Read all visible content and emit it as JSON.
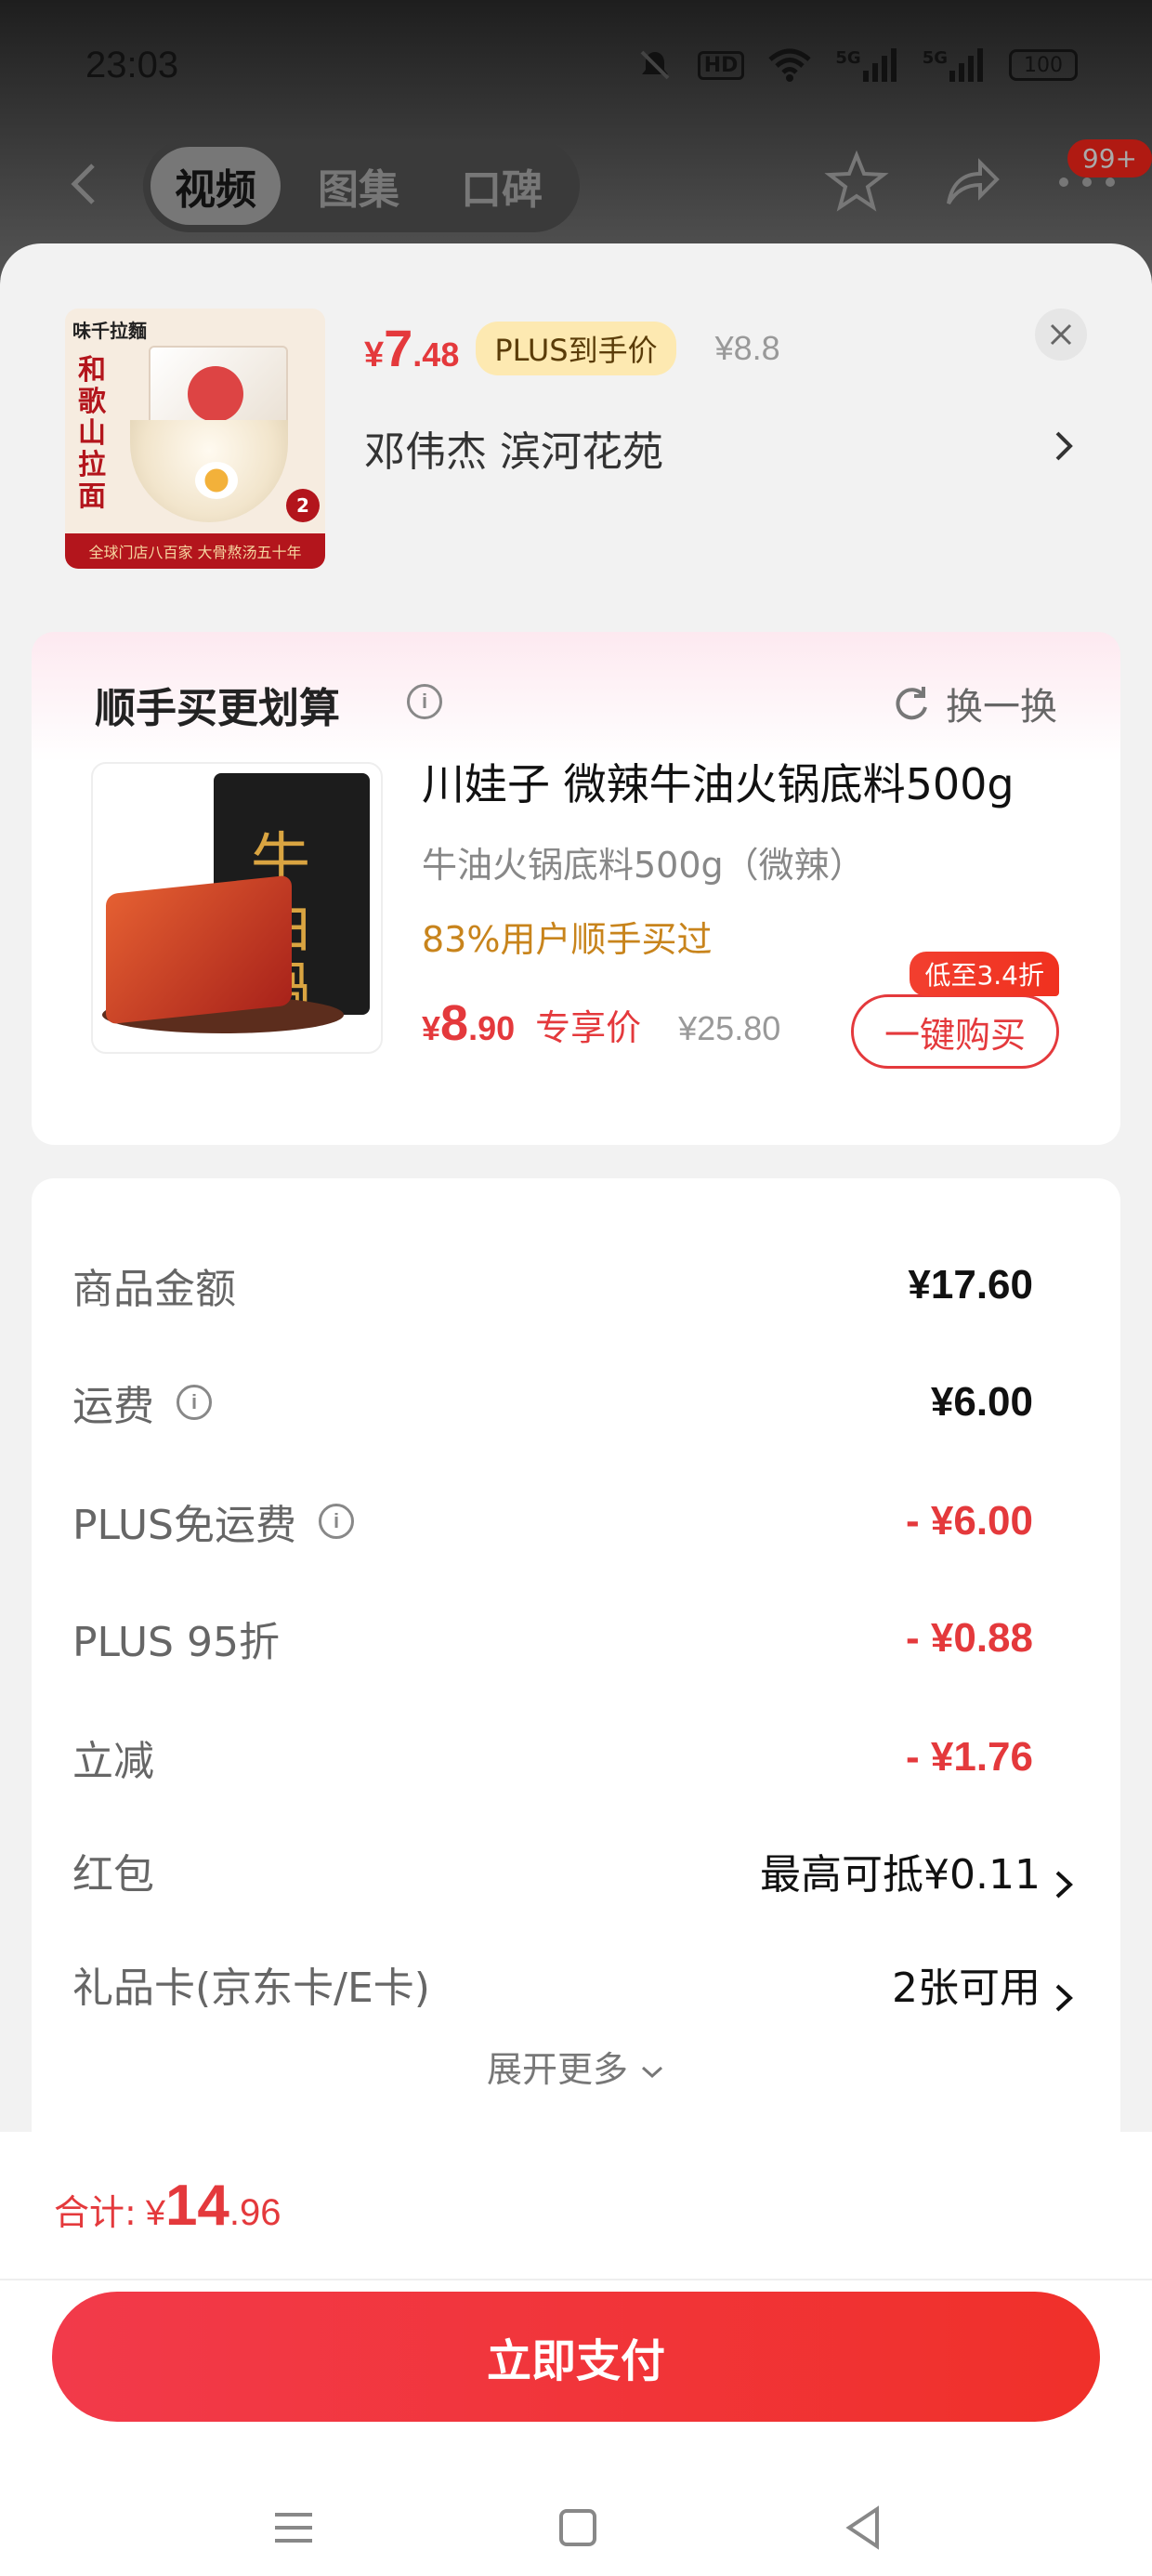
{
  "status_bar": {
    "time": "23:03",
    "battery": "100",
    "hd": "HD",
    "net1": "5G",
    "net2": "5G"
  },
  "top_nav": {
    "tabs": [
      {
        "label": "视频",
        "active": true
      },
      {
        "label": "图集"
      },
      {
        "label": "口碑"
      }
    ],
    "badge": "99+"
  },
  "product": {
    "price_symbol": "¥",
    "price_int": "7",
    "price_dec": ".48",
    "plus_tag": "PLUS到手价",
    "old_price": "¥8.8",
    "address": "邓伟杰  滨河花苑",
    "thumb_brand": "味千拉麵",
    "thumb_title": "和歌山拉面",
    "thumb_band": "全球门店八百家  大骨熬汤五十年",
    "thumb_count": "2"
  },
  "bundle": {
    "title": "顺手买更划算",
    "refresh_label": "换一换",
    "name": "川娃子 微辣牛油火锅底料500g",
    "spec": "牛油火锅底料500g（微辣）",
    "social_proof": "83%用户顺手买过",
    "price_symbol": "¥",
    "price_int": "8",
    "price_dec": ".90",
    "price_tag": "专享价",
    "old_price": "¥25.80",
    "discount_tag": "低至3.4折",
    "buy_label": "一键购买",
    "package_glyph": "牛油鍋"
  },
  "costs": {
    "rows": [
      {
        "label": "商品金额",
        "value": "¥17.60"
      },
      {
        "label": "运费",
        "value": "¥6.00"
      },
      {
        "label": "PLUS免运费",
        "value": "- ¥6.00"
      },
      {
        "label": "PLUS 95折",
        "value": "- ¥0.88"
      },
      {
        "label": "立减",
        "value": "- ¥1.76"
      },
      {
        "label": "红包",
        "value": "最高可抵¥0.11"
      },
      {
        "label": "礼品卡(京东卡/E卡)",
        "value": "2张可用"
      }
    ],
    "expand_label": "展开更多"
  },
  "footer": {
    "total_label": "合计:",
    "total_symbol": "¥",
    "total_int": "14",
    "total_dec": ".96",
    "pay_label": "立即支付"
  },
  "colors": {
    "accent": "#e4393c",
    "plus_tag_bg": "#fde9b1",
    "social_orange": "#c8841c"
  },
  "icons": [
    "back-arrow-icon",
    "star-icon",
    "share-icon",
    "more-icon",
    "close-icon",
    "info-icon",
    "refresh-icon",
    "chevron-right-icon",
    "chevron-down-icon",
    "menu-icon",
    "home-icon",
    "back-triangle-icon"
  ]
}
